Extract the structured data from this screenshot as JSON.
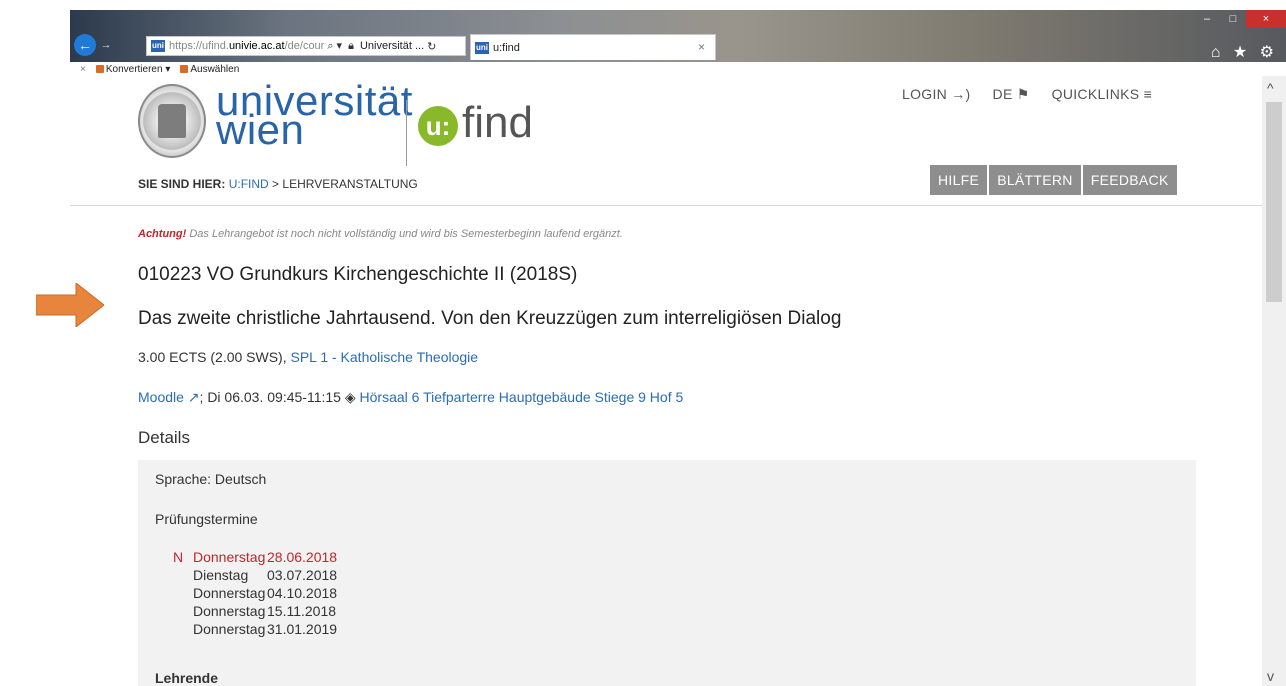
{
  "browser": {
    "url_prefix": "https://ufind.",
    "url_domain": "univie.ac.at",
    "url_path": "/de/cour",
    "site_identity": "Universität ...",
    "tab_title": "u:find",
    "tab_close": "×",
    "favicon_label": "uni",
    "win_min": "–",
    "win_max": "□",
    "win_close": "×",
    "right_icons": "⌂ ★ ⚙"
  },
  "favorites_bar": {
    "close": "×",
    "convert_label": "Konvertieren ▾",
    "select_label": "Auswählen"
  },
  "header": {
    "uni_name_line1": "universität",
    "uni_name_line2": "wien",
    "ufind_badge": "u:",
    "ufind_text": "find",
    "login": "LOGIN →)",
    "lang": "DE ⚑",
    "quicklinks": "QUICKLINKS ≡",
    "breadcrumb_label": "SIE SIND HIER:",
    "breadcrumb_link": "U:FIND",
    "breadcrumb_sep": ">",
    "breadcrumb_current": "LEHRVERANSTALTUNG",
    "buttons": [
      "HILFE",
      "BLÄTTERN",
      "FEEDBACK"
    ]
  },
  "notice": {
    "warn": "Achtung!",
    "text": "Das Lehrangebot ist noch nicht vollständig und wird bis Semesterbeginn laufend ergänzt."
  },
  "course": {
    "title": "010223 VO Grundkurs Kirchengeschichte II (2018S)",
    "subtitle": "Das zweite christliche Jahrtausend. Von den Kreuzzügen zum interreligiösen Dialog",
    "ects": "3.00 ECTS (2.00 SWS),",
    "spl_link": "SPL 1 - Katholische Theologie",
    "moodle": "Moodle ↗",
    "session_time": "; Di 06.03. 09:45-11:15 ",
    "location_icon": "◈",
    "location": "Hörsaal 6 Tiefparterre Hauptgebäude Stiege 9 Hof 5"
  },
  "details": {
    "heading": "Details",
    "language": "Sprache: Deutsch",
    "exam_heading": "Prüfungstermine",
    "exams": [
      {
        "flag": "N",
        "day": "Donnerstag",
        "date": "28.06.2018"
      },
      {
        "flag": "",
        "day": "Dienstag",
        "date": "03.07.2018"
      },
      {
        "flag": "",
        "day": "Donnerstag",
        "date": "04.10.2018"
      },
      {
        "flag": "",
        "day": "Donnerstag",
        "date": "15.11.2018"
      },
      {
        "flag": "",
        "day": "Donnerstag",
        "date": "31.01.2019"
      }
    ],
    "lecturers_heading": "Lehrende"
  },
  "scrollbar": {
    "up": "^",
    "down": "v"
  },
  "colors": {
    "brand_blue": "#2864a8",
    "ufind_green": "#89b92a",
    "link": "#2a6cb8",
    "warn_red": "#c3242b",
    "arrow_orange": "#e8853d"
  }
}
